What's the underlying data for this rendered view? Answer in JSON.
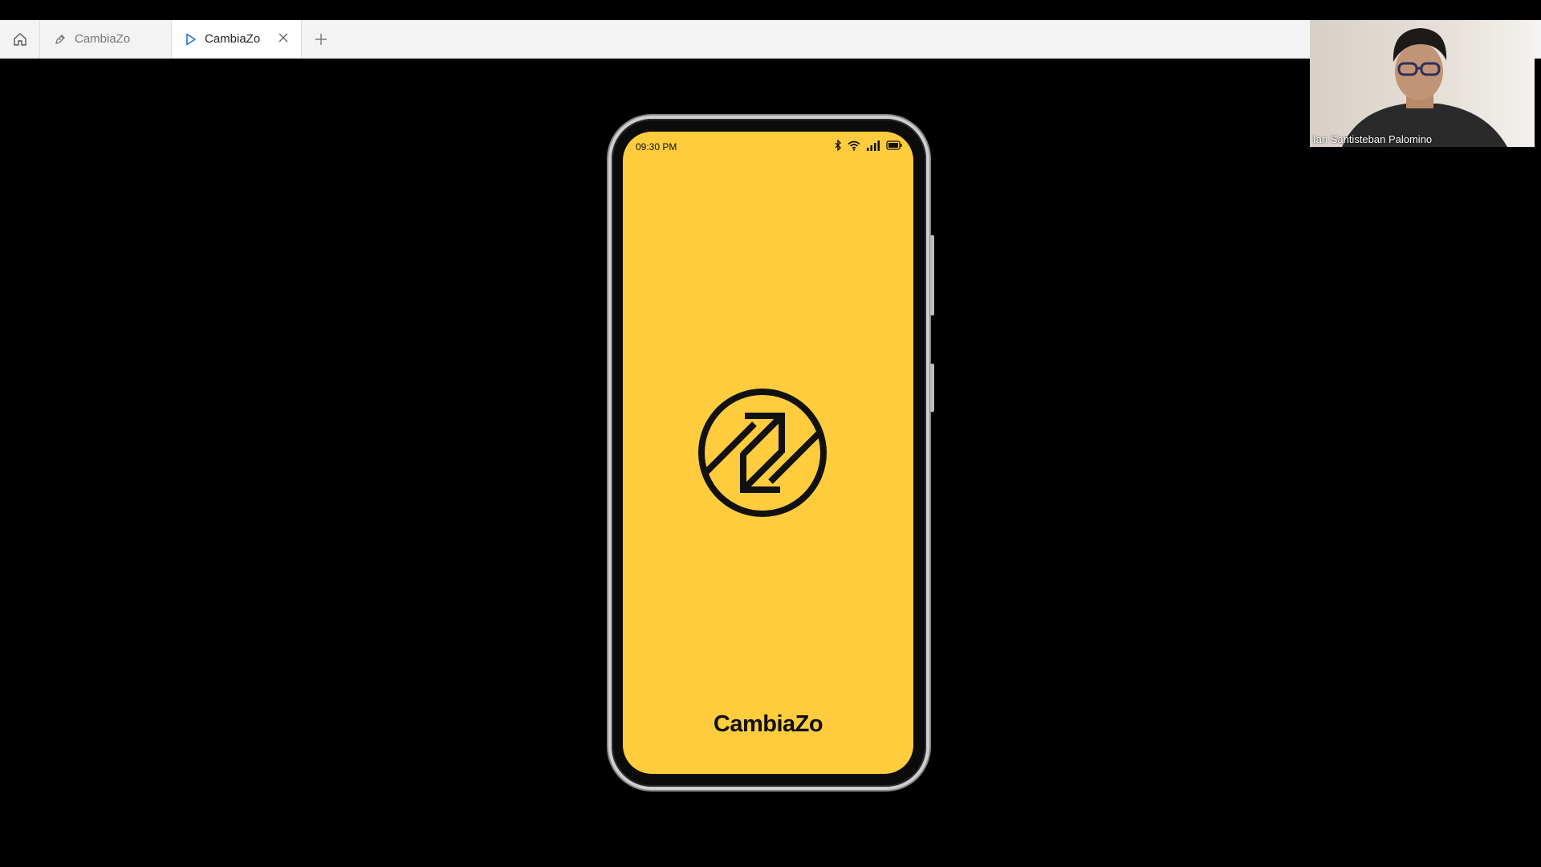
{
  "tabs": [
    {
      "label": "CambiaZo",
      "icon": "pen-icon",
      "active": false
    },
    {
      "label": "CambiaZo",
      "icon": "play-icon",
      "active": true
    }
  ],
  "phone": {
    "status_time": "09:30 PM",
    "app_name": "CambiaZo",
    "background_color": "#ffcc3d",
    "status_icons": [
      "bluetooth-icon",
      "wifi-icon",
      "signal-icon",
      "battery-icon"
    ]
  },
  "webcam": {
    "participant_name": "Ian Santisteban Palomino"
  },
  "colors": {
    "accent_play": "#1a73e8",
    "tabbar_bg": "#f3f3f3",
    "stage_bg": "#000000"
  }
}
